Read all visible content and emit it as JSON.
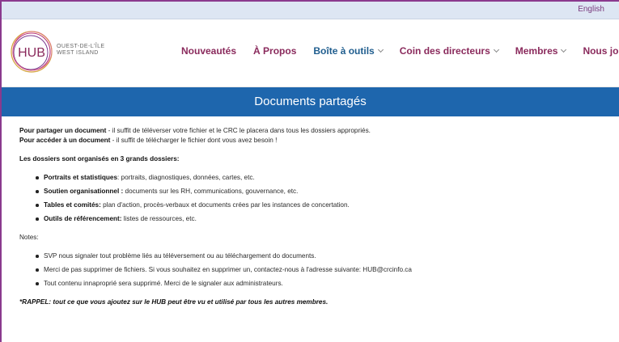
{
  "topbar": {
    "language_link": "English"
  },
  "logo": {
    "mark": "HUB",
    "line1": "OUEST-DE-L'ÎLE",
    "line2": "WEST ISLAND"
  },
  "nav": [
    {
      "label": "Nouveautés",
      "dropdown": false
    },
    {
      "label": "À Propos",
      "dropdown": false
    },
    {
      "label": "Boîte à outils",
      "dropdown": true
    },
    {
      "label": "Coin des directeurs",
      "dropdown": true
    },
    {
      "label": "Membres",
      "dropdown": true
    },
    {
      "label": "Nous joindre",
      "dropdown": false
    }
  ],
  "banner": {
    "title": "Documents partagés"
  },
  "content": {
    "share_bold": "Pour partager un document",
    "share_text": " - il suffit de téléverser votre fichier et le CRC le placera dans tous les dossiers appropriés.",
    "access_bold": "Pour accéder à un document",
    "access_text": " - il suffit de télécharger le fichier dont vous avez besoin !",
    "folders_heading": "Les dossiers sont organisés en 3 grands dossiers:",
    "folders": [
      {
        "bold": "Portraits et statistiques",
        "text": ": portraits, diagnostiques, données, cartes, etc."
      },
      {
        "bold": "Soutien organisationnel :",
        "text": " documents sur les RH, communications, gouvernance, etc."
      },
      {
        "bold": "Tables et comités:",
        "text": " plan d'action, procès-verbaux et documents crées par les instances de concertation."
      },
      {
        "bold": "Outils de référencement:",
        "text": " listes de ressources, etc."
      }
    ],
    "notes_label": "Notes:",
    "notes": [
      "SVP nous signaler tout problème liés au téléversement ou au téléchargement do documents.",
      "Merci de pas supprimer de fichiers. Si vous souhaitez en supprimer un, contactez-nous à l'adresse suivante: HUB@crcinfo.ca",
      "Tout contenu innaproprié sera supprimé. Merci de le signaler aux administrateurs."
    ],
    "reminder": "*RAPPEL: tout ce que vous ajoutez sur le HUB peut être vu et utilisé par tous les autres membres."
  }
}
